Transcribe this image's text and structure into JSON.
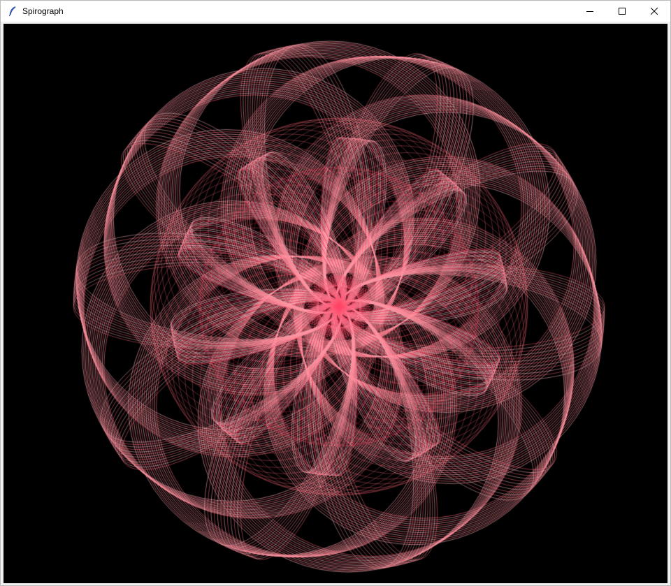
{
  "window": {
    "title": "Spirograph",
    "app_icon": "feather-icon",
    "controls": [
      "minimize-icon",
      "maximize-icon",
      "close-icon"
    ]
  },
  "canvas": {
    "background": "#000000",
    "palette": {
      "outer": "#ffb6c1",
      "mid": "#ff6b7a",
      "inner": "#ff3355",
      "core": "#ff4466"
    }
  }
}
